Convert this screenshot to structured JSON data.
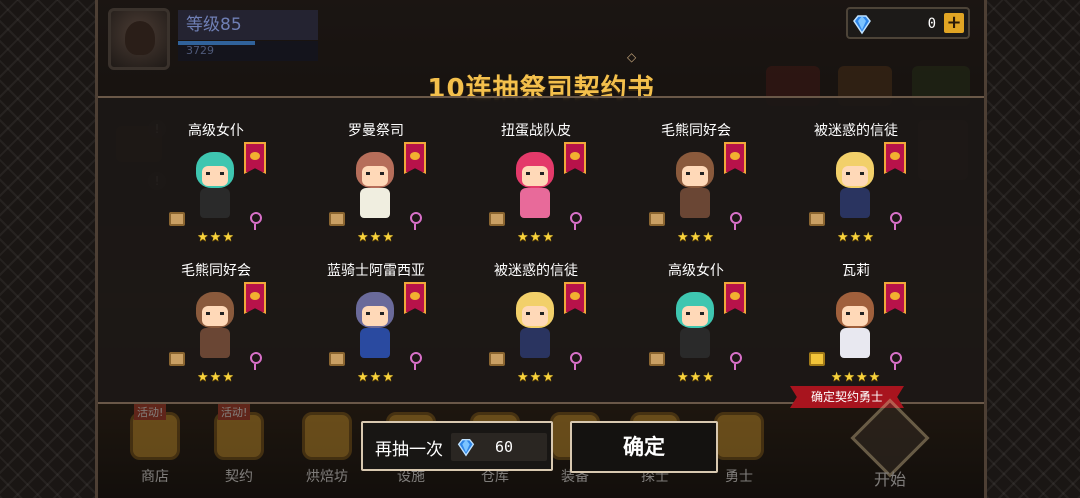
{
  "player": {
    "level_label": "等级85",
    "xp": "3729",
    "xp_fill": 0.55
  },
  "currency": {
    "gems": "0",
    "plus": "+"
  },
  "dialog": {
    "title": "10连抽祭司契约书",
    "ornament": "◇",
    "ribbon": "确定契约勇士"
  },
  "heroes": [
    {
      "name": "高级女仆",
      "stars": "★★★",
      "hair": "#3ec6b0",
      "body": "#2a2a2a"
    },
    {
      "name": "罗曼祭司",
      "stars": "★★★",
      "hair": "#b66e5a",
      "body": "#f0eee0"
    },
    {
      "name": "扭蛋战队皮",
      "stars": "★★★",
      "hair": "#e43a6a",
      "body": "#e86a9a"
    },
    {
      "name": "毛熊同好会",
      "stars": "★★★",
      "hair": "#8a5a3c",
      "body": "#6a4634"
    },
    {
      "name": "被迷惑的信徒",
      "stars": "★★★",
      "hair": "#f2d06a",
      "body": "#2a3460"
    },
    {
      "name": "毛熊同好会",
      "stars": "★★★",
      "hair": "#8a5a3c",
      "body": "#6a4634"
    },
    {
      "name": "蓝骑士阿雷西亚",
      "stars": "★★★",
      "hair": "#6a6a9a",
      "body": "#2a4aa0"
    },
    {
      "name": "被迷惑的信徒",
      "stars": "★★★",
      "hair": "#f2d06a",
      "body": "#2a3460"
    },
    {
      "name": "高级女仆",
      "stars": "★★★",
      "hair": "#3ec6b0",
      "body": "#2a2a2a"
    },
    {
      "name": "瓦莉",
      "stars": "★★★★",
      "hair": "#a0603c",
      "body": "#e8e8f0"
    }
  ],
  "buttons": {
    "again_label": "再抽一次",
    "again_price": "60",
    "confirm_label": "确定"
  },
  "nav": [
    {
      "label": "商店",
      "tag": "活动!"
    },
    {
      "label": "契约",
      "tag": "活动!"
    },
    {
      "label": "烘焙坊",
      "tag": ""
    },
    {
      "label": "设施",
      "tag": ""
    },
    {
      "label": "仓库",
      "tag": ""
    },
    {
      "label": "装备",
      "tag": ""
    },
    {
      "label": "探士",
      "tag": ""
    },
    {
      "label": "勇士",
      "tag": ""
    }
  ],
  "start_label": "开始",
  "colors": {
    "title": "#f4c04c",
    "star": "#f7d23c",
    "ribbon": "#a8141e",
    "gem": "#2f86e8"
  }
}
